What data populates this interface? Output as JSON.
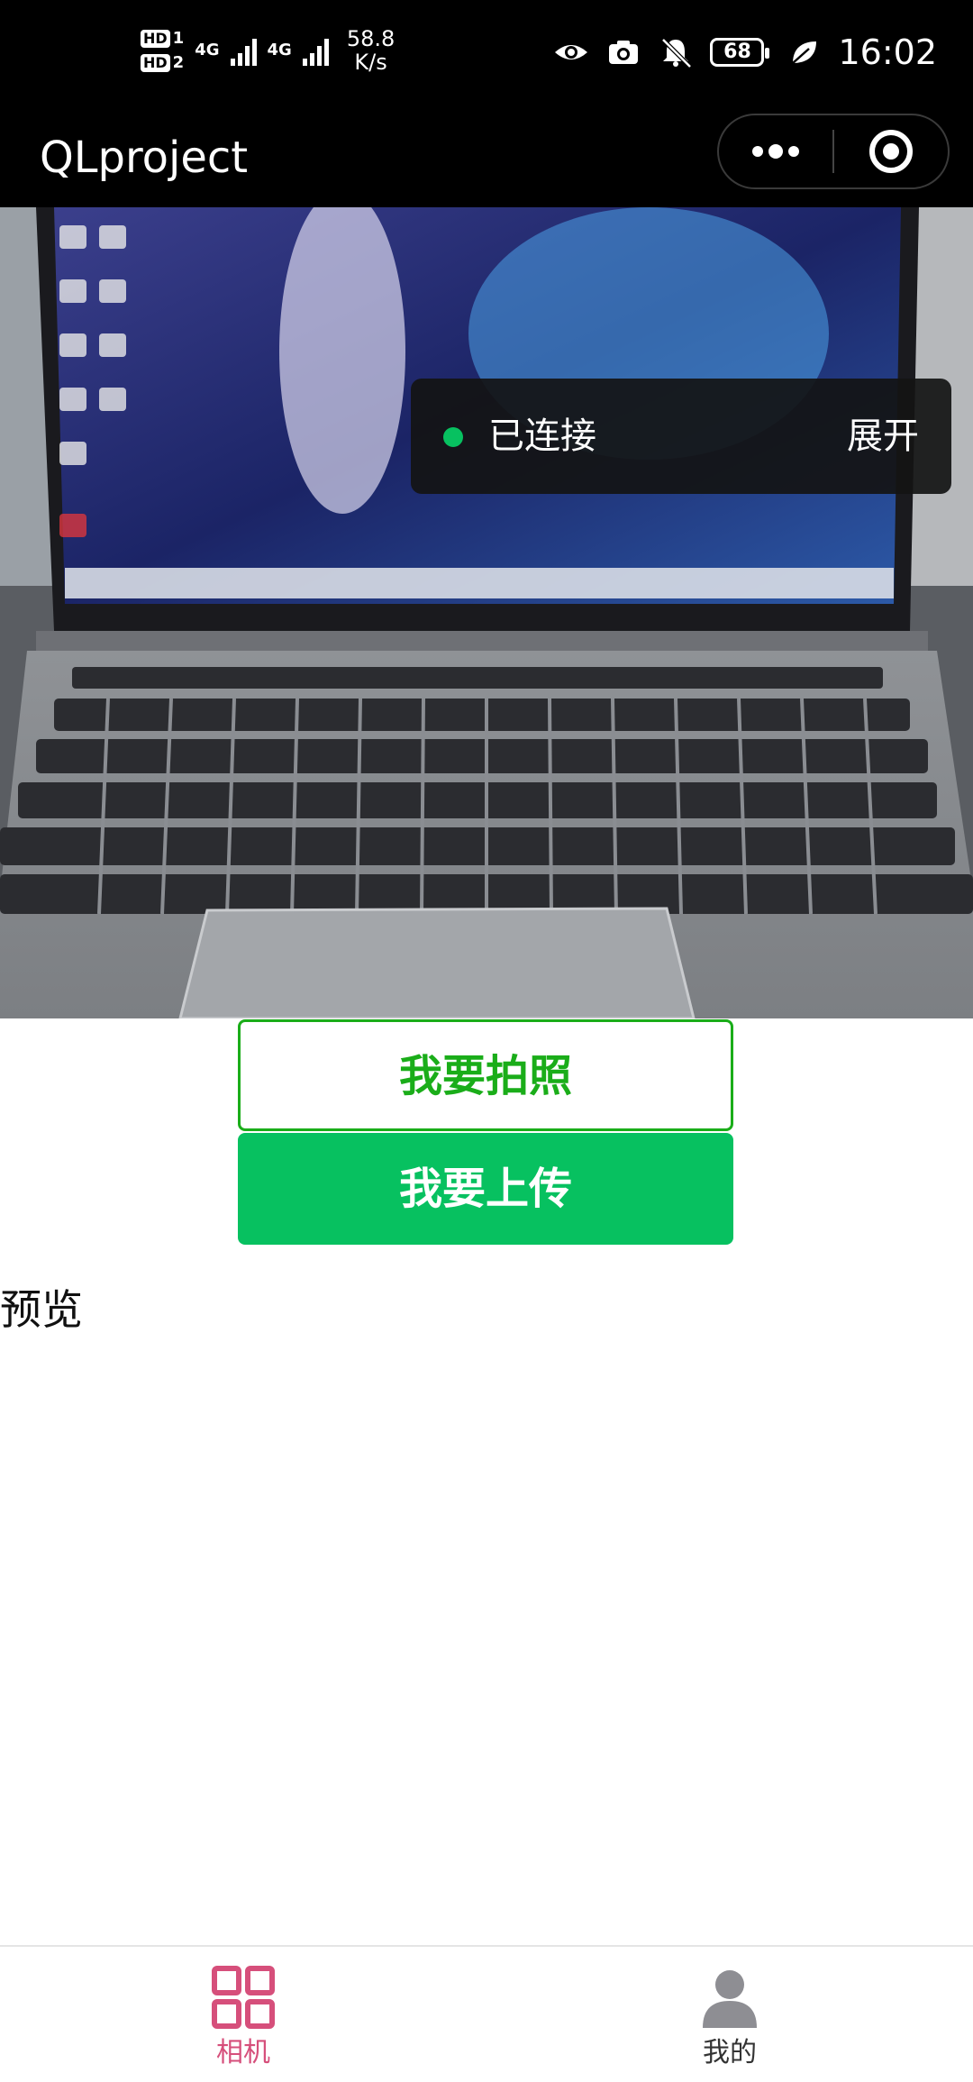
{
  "status_bar": {
    "sim1": "HD",
    "sim1_num": "1",
    "sim2": "HD",
    "sim2_num": "2",
    "net1": "4G",
    "net2": "4G",
    "speed_value": "58.8",
    "speed_unit": "K/s",
    "battery": "68",
    "time": "16:02",
    "icons": [
      "eye-icon",
      "camera-icon",
      "bell-muted-icon",
      "battery-icon",
      "leaf-icon"
    ]
  },
  "title_bar": {
    "title": "QLproject",
    "more_icon": "more-dots-icon",
    "close_icon": "target-icon"
  },
  "camera": {
    "status": "已连接",
    "expand": "展开",
    "status_color": "#07c160"
  },
  "actions": {
    "photo_label": "我要拍照",
    "upload_label": "我要上传",
    "accent": "#07c160"
  },
  "preview": {
    "label": "预览"
  },
  "tab_bar": {
    "tabs": [
      {
        "label": "相机",
        "icon": "grid-icon",
        "active": true,
        "color": "#d64f7b"
      },
      {
        "label": "我的",
        "icon": "user-icon",
        "active": false,
        "color": "#333333"
      }
    ]
  }
}
